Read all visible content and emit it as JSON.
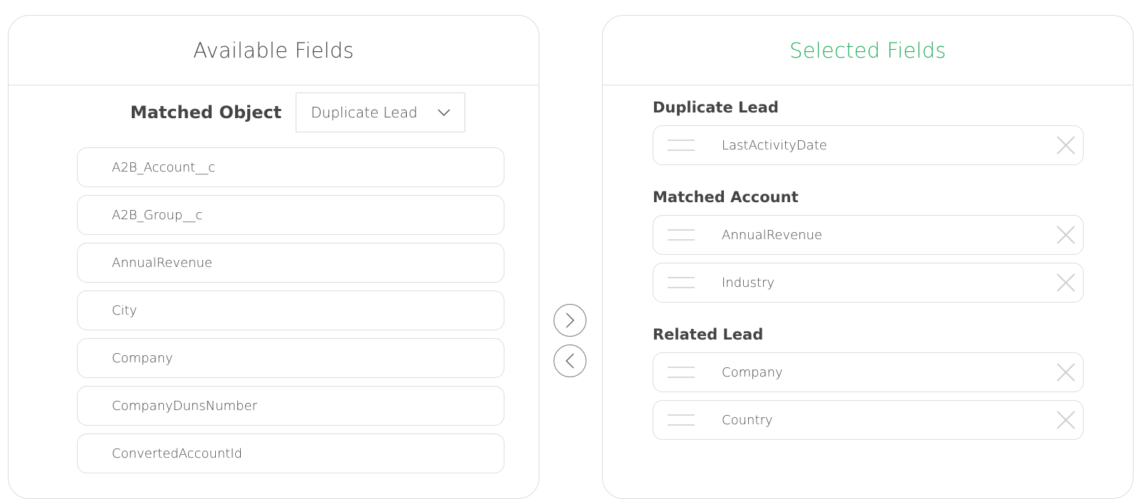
{
  "available_panel": {
    "title": "Available Fields",
    "matched_object_label": "Matched Object",
    "matched_object_value": "Duplicate Lead",
    "fields": [
      "A2B_Account__c",
      "A2B_Group__c",
      "AnnualRevenue",
      "City",
      "Company",
      "CompanyDunsNumber",
      "ConvertedAccountId"
    ]
  },
  "selected_panel": {
    "title": "Selected Fields",
    "groups": [
      {
        "title": "Duplicate Lead",
        "fields": [
          "LastActivityDate"
        ]
      },
      {
        "title": "Matched Account",
        "fields": [
          "AnnualRevenue",
          "Industry"
        ]
      },
      {
        "title": "Related Lead",
        "fields": [
          "Company",
          "Country"
        ]
      }
    ]
  },
  "icons": {
    "move_right": "chevron-right-icon",
    "move_left": "chevron-left-icon",
    "dropdown": "chevron-down-icon",
    "remove": "close-icon",
    "drag": "drag-handle-icon"
  },
  "colors": {
    "selected_title": "#27ae60",
    "border": "#dcdcdc",
    "text": "#444444"
  }
}
